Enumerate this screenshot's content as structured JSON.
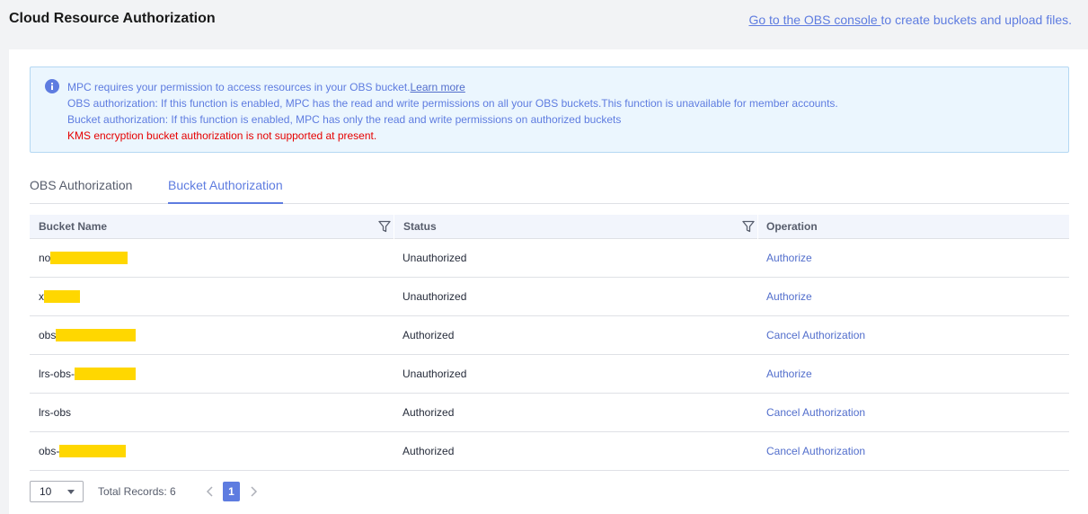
{
  "header": {
    "title": "Cloud Resource Authorization",
    "console_link": "Go to the OBS console ",
    "console_rest": "to create buckets and upload files."
  },
  "notice": {
    "line1_text": "MPC requires your permission to access resources in your OBS bucket.",
    "line1_link": "Learn more",
    "line2": "OBS authorization: If this function is enabled, MPC has the read and write permissions on all your OBS buckets.This function is unavailable for member accounts.",
    "line3": "Bucket authorization: If this function is enabled, MPC has only the read and write permissions on authorized buckets",
    "line4": "KMS encryption bucket authorization is not supported at present."
  },
  "tabs": [
    {
      "label": "OBS Authorization",
      "active": false
    },
    {
      "label": "Bucket Authorization",
      "active": true
    }
  ],
  "table": {
    "headers": {
      "name": "Bucket Name",
      "status": "Status",
      "operation": "Operation"
    },
    "rows": [
      {
        "name": "no",
        "status": "Unauthorized",
        "operation": "Authorize"
      },
      {
        "name": "x",
        "status": "Unauthorized",
        "operation": "Authorize"
      },
      {
        "name": "obs",
        "status": "Authorized",
        "operation": "Cancel Authorization"
      },
      {
        "name": "lrs-obs-",
        "status": "Unauthorized",
        "operation": "Authorize"
      },
      {
        "name": "lrs-obs",
        "status": "Authorized",
        "operation": "Cancel Authorization"
      },
      {
        "name": "obs-",
        "status": "Authorized",
        "operation": "Cancel Authorization"
      }
    ]
  },
  "pager": {
    "page_size": "10",
    "total": "Total Records: 6",
    "current_page": "1"
  },
  "colors": {
    "accent": "#5e7ce0",
    "warning": "#e60000",
    "redaction": "#ffd700"
  }
}
